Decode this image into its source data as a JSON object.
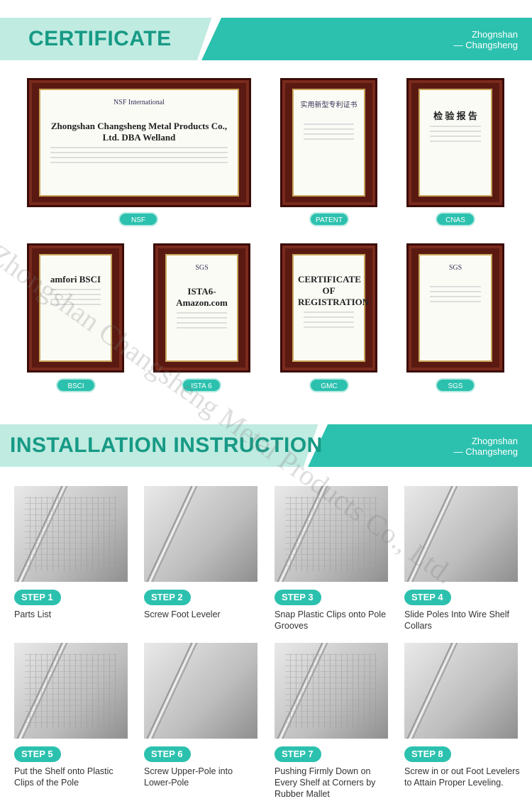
{
  "certificate_section": {
    "title": "CERTIFICATE",
    "brand_line1": "Zhognshan",
    "brand_line2": "— Changsheng"
  },
  "certificates": [
    {
      "label": "NSF",
      "header": "NSF International",
      "body": "Zhongshan Changsheng Metal Products Co., Ltd. DBA Welland"
    },
    {
      "label": "PATENT",
      "header": "实用新型专利证书",
      "body": ""
    },
    {
      "label": "CNAS",
      "header": "",
      "body": "检 验 报 告"
    },
    {
      "label": "BSCI",
      "header": "",
      "body": "amfori BSCI"
    },
    {
      "label": "ISTA 6",
      "header": "SGS",
      "body": "ISTA6-Amazon.com"
    },
    {
      "label": "GMC",
      "header": "",
      "body": "CERTIFICATE OF REGISTRATION"
    },
    {
      "label": "SGS",
      "header": "SGS",
      "body": ""
    }
  ],
  "installation_section": {
    "title": "INSTALLATION INSTRUCTION",
    "brand_line1": "Zhognshan",
    "brand_line2": "— Changsheng"
  },
  "steps": [
    {
      "label": "STEP 1",
      "desc": "Parts List"
    },
    {
      "label": "STEP 2",
      "desc": "Screw Foot Leveler"
    },
    {
      "label": "STEP 3",
      "desc": "Snap Plastic Clips onto Pole Grooves"
    },
    {
      "label": "STEP 4",
      "desc": "Slide Poles Into Wire Shelf Collars"
    },
    {
      "label": "STEP 5",
      "desc": "Put the Shelf onto Plastic Clips of the Pole"
    },
    {
      "label": "STEP 6",
      "desc": "Screw Upper-Pole into Lower-Pole"
    },
    {
      "label": "STEP 7",
      "desc": "Pushing Firmly Down on Every Shelf at Corners by Rubber Mallet"
    },
    {
      "label": "STEP 8",
      "desc": "Screw in or out Foot Levelers to Attain Proper Leveling."
    }
  ],
  "watermark": "Zhongshan Changsheng Metal Products Co., Ltd.",
  "colors": {
    "accent": "#2cc1ae",
    "accent_light": "#c0ebe1",
    "title_text": "#169a85",
    "frame": "#5a1a12"
  }
}
